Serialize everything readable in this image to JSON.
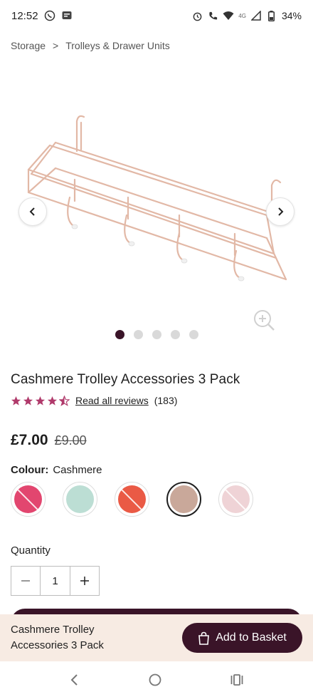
{
  "status_bar": {
    "time": "12:52",
    "network_label": "4G",
    "battery": "34%"
  },
  "breadcrumb": {
    "items": [
      "Storage",
      "Trolleys & Drawer Units"
    ],
    "separator": ">"
  },
  "gallery": {
    "dots_count": 5,
    "active_index": 0
  },
  "product": {
    "title": "Cashmere Trolley Accessories 3 Pack",
    "rating": 4.5,
    "reviews_link": "Read all reviews",
    "review_count": "(183)",
    "price_current": "£7.00",
    "price_was": "£9.00",
    "colour_label": "Colour:",
    "colour_value": "Cashmere",
    "swatches": [
      {
        "name": "pink",
        "color": "#e2466f",
        "available": false
      },
      {
        "name": "mint",
        "color": "#bcded4",
        "available": true
      },
      {
        "name": "coral",
        "color": "#ea5a45",
        "available": false
      },
      {
        "name": "cashmere",
        "color": "#c9a89a",
        "available": true,
        "selected": true
      },
      {
        "name": "blush",
        "color": "#efd3d6",
        "available": false
      }
    ],
    "quantity_label": "Quantity",
    "quantity_value": "1"
  },
  "sticky_bar": {
    "title": "Cashmere Trolley Accessories 3 Pack",
    "add_button_label": "Add to Basket"
  },
  "colors": {
    "brand": "#3a1428",
    "sticky_bg": "#f7ebe3",
    "star": "#b03a6b",
    "wire": "#e2b8a6"
  }
}
